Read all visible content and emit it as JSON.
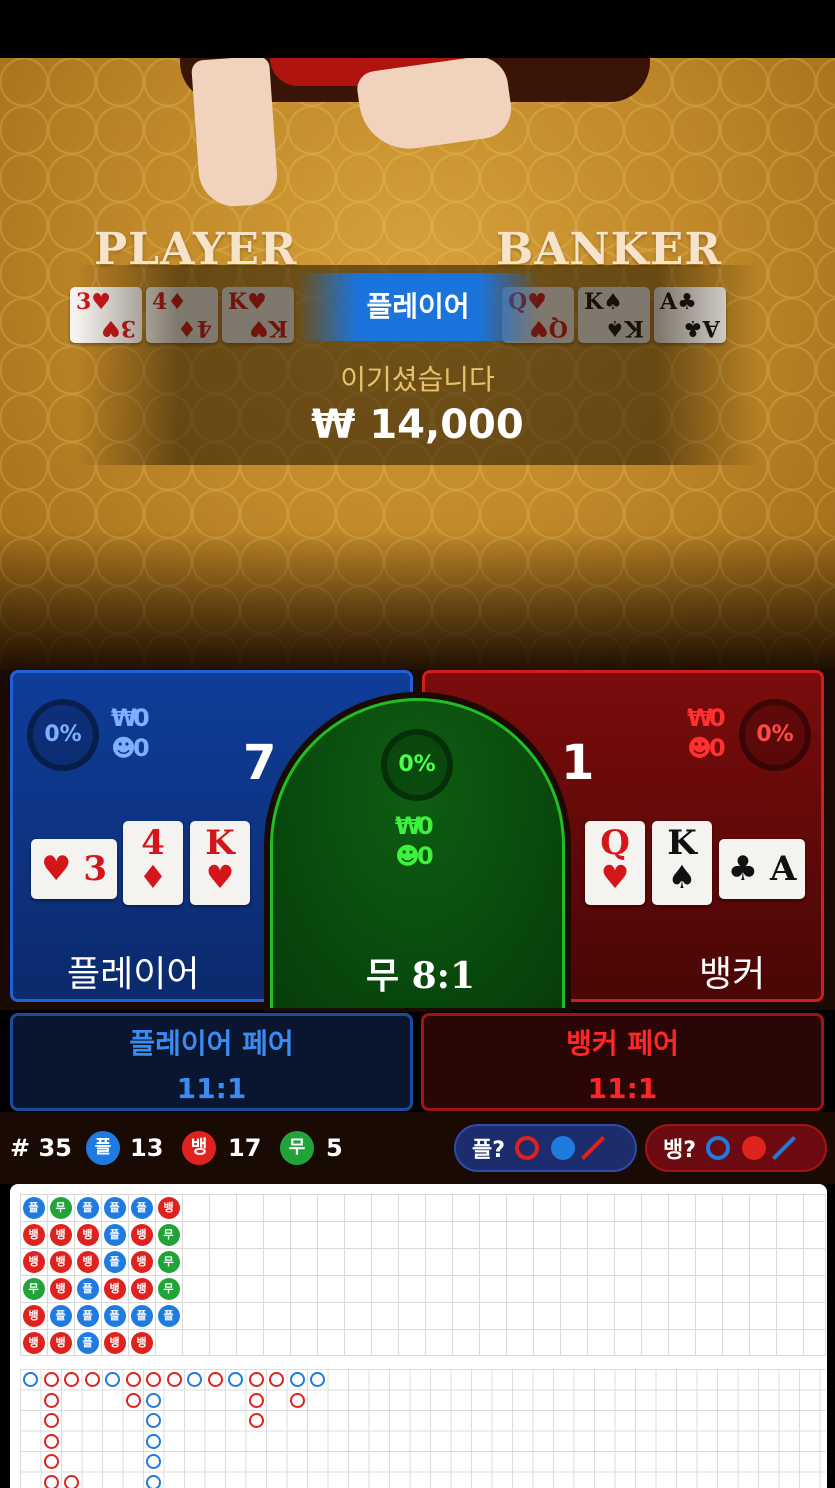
{
  "table": {
    "player_label": "PLAYER",
    "banker_label": "BANKER",
    "player_cards": [
      {
        "rank": "3",
        "suit": "♥",
        "color": "red"
      },
      {
        "rank": "4",
        "suit": "♦",
        "color": "red"
      },
      {
        "rank": "K",
        "suit": "♥",
        "color": "red"
      }
    ],
    "banker_cards": [
      {
        "rank": "Q",
        "suit": "♥",
        "color": "red"
      },
      {
        "rank": "K",
        "suit": "♠",
        "color": "black"
      },
      {
        "rank": "A",
        "suit": "♣",
        "color": "black"
      }
    ]
  },
  "result": {
    "winner": "플레이어",
    "message": "이기셨습니다",
    "amount": "₩ 14,000"
  },
  "player_panel": {
    "percent": "0%",
    "stake_icon": "₩",
    "stake": "0",
    "players_icon": "person-icon",
    "players": "0",
    "score": "7",
    "label": "플레이어",
    "cards": [
      {
        "rank": "3",
        "suit": "♥",
        "color": "red",
        "rotated": true
      },
      {
        "rank": "4",
        "suit": "♦",
        "color": "red"
      },
      {
        "rank": "K",
        "suit": "♥",
        "color": "red"
      }
    ]
  },
  "tie_panel": {
    "percent": "0%",
    "stake_icon": "₩",
    "stake": "0",
    "players": "0",
    "label": "무 8:1"
  },
  "banker_panel": {
    "percent": "0%",
    "stake_icon": "₩",
    "stake": "0",
    "players": "0",
    "score": "1",
    "label": "뱅커",
    "cards": [
      {
        "rank": "Q",
        "suit": "♥",
        "color": "red"
      },
      {
        "rank": "K",
        "suit": "♠",
        "color": "black"
      },
      {
        "rank": "A",
        "suit": "♣",
        "color": "black",
        "rotated": true
      }
    ]
  },
  "player_pair": {
    "title": "플레이어 페어",
    "odds": "11:1"
  },
  "banker_pair": {
    "title": "뱅커 페어",
    "odds": "11:1"
  },
  "stats": {
    "round": "# 35",
    "player_symbol": "플",
    "player_count": "13",
    "banker_symbol": "뱅",
    "banker_count": "17",
    "tie_symbol": "무",
    "tie_count": "5"
  },
  "predict": {
    "player_label": "플?",
    "banker_label": "뱅?"
  },
  "colors": {
    "player": "#1f7be0",
    "banker": "#e0221f",
    "tie": "#22a33a"
  },
  "bead_road": [
    [
      "P",
      "T",
      "P",
      "P",
      "P",
      "B"
    ],
    [
      "B",
      "B",
      "B",
      "P",
      "B",
      "T"
    ],
    [
      "B",
      "B",
      "B",
      "P",
      "B",
      "T"
    ],
    [
      "T",
      "B",
      "P",
      "B",
      "B",
      "T"
    ],
    [
      "B",
      "P",
      "P",
      "P",
      "P",
      "P"
    ],
    [
      "B",
      "B",
      "P",
      "B",
      "B"
    ]
  ],
  "bead_labels": {
    "P": "플",
    "B": "뱅",
    "T": "무"
  },
  "big_road": [
    [
      "P",
      "B",
      "B",
      "B",
      "P",
      "B",
      "B",
      "B",
      "P",
      "B",
      "P",
      "B",
      "B",
      "P",
      "P"
    ],
    [
      "",
      "B",
      "",
      "",
      "",
      "B",
      "P",
      "",
      "",
      "",
      "",
      "B",
      "",
      "B"
    ],
    [
      "",
      "B",
      "",
      "",
      "",
      "",
      "P",
      "",
      "",
      "",
      "",
      "B"
    ],
    [
      "",
      "B",
      "",
      "",
      "",
      "",
      "P"
    ],
    [
      "",
      "B",
      "",
      "",
      "",
      "",
      "P"
    ],
    [
      "",
      "B",
      "B",
      "",
      "",
      "",
      "P"
    ]
  ]
}
